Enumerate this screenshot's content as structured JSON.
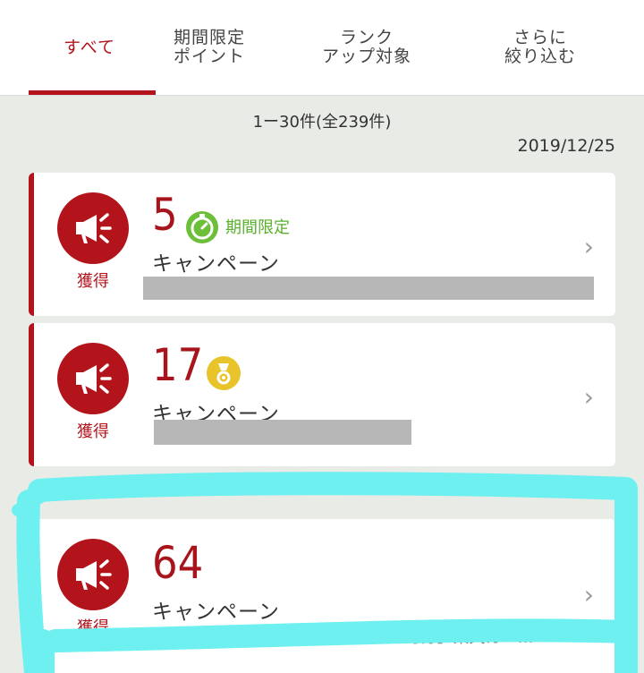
{
  "tabs": [
    {
      "label": "すべて",
      "active": true
    },
    {
      "label": "期間限定\nポイント",
      "active": false
    },
    {
      "label": "ランク\nアップ対象",
      "active": false
    },
    {
      "label": "さらに\n絞り込む",
      "active": false
    }
  ],
  "summary": {
    "count_text": "1ー30件(全239件)",
    "date": "2019/12/25"
  },
  "cards": [
    {
      "badge_label": "獲得",
      "points": "5",
      "tag": "期間限定",
      "tag_icon": "stopwatch-icon",
      "type": "キャンペーン",
      "description": ""
    },
    {
      "badge_label": "獲得",
      "points": "17",
      "tag_icon": "medal-icon",
      "type": "キャンペーン",
      "description": ""
    },
    {
      "badge_label": "獲得",
      "points": "64",
      "type": "キャンペーン",
      "description": "【キャッシュレス還元ポイント10月分】楽天カー…"
    }
  ],
  "colors": {
    "accent": "#b3141c",
    "limited": "#58b02c",
    "medal": "#e8c32a",
    "highlight": "#6ff0f0"
  }
}
